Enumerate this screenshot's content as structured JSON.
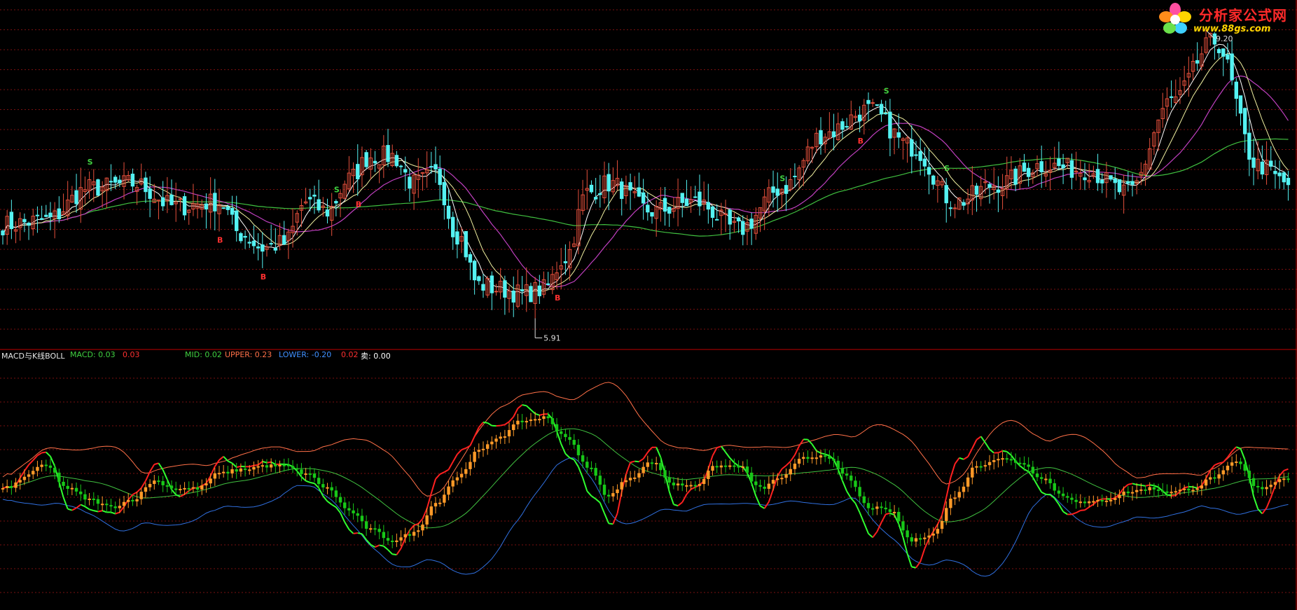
{
  "logo": {
    "name": "分析家公式网",
    "url": "www.88gs.com"
  },
  "colors": {
    "bg": "#000000",
    "grid": "#7a1010",
    "up": "#e5503c",
    "down": "#54f2f2",
    "ma_short": "#ffffff",
    "ma_mid": "#f0f0a0",
    "ma_long": "#c040c0",
    "ma_longest": "#40c040",
    "bar_up": "#ff9a28",
    "bar_down": "#18c818",
    "upper": "#ff7048",
    "mid": "#40c040",
    "lower": "#3070e0",
    "red_line": "#ff2020",
    "green_line": "#30ff30",
    "divider": "#c00000"
  },
  "price_panel": {
    "high_label": "9.20",
    "low_label": "5.91"
  },
  "indicator_legend": {
    "title": "MACD与K线BOLL",
    "macd_label": "MACD: 0.03",
    "macd_value2": "0.03",
    "mid_label": "MID: 0.02",
    "upper_label": "UPPER: 0.23",
    "lower_label": "LOWER: -0.20",
    "value4": "0.02",
    "sell_label": "卖: 0.00"
  },
  "chart_data": [
    {
      "type": "candlestick",
      "title": "",
      "series": [
        {
          "name": "",
          "anchors_x": [
            0,
            10,
            20,
            30,
            40,
            50,
            55,
            60,
            65,
            70,
            75,
            80,
            85,
            90,
            95,
            100,
            105,
            110,
            115,
            120,
            125,
            130,
            135,
            140,
            150,
            160,
            170,
            180,
            190,
            200,
            210,
            220,
            230,
            240,
            250,
            260,
            270,
            280,
            290,
            297
          ],
          "anchors_close": [
            6.95,
            7.0,
            7.35,
            7.4,
            7.15,
            7.2,
            6.85,
            6.7,
            6.75,
            7.2,
            7.1,
            7.45,
            7.7,
            7.7,
            7.4,
            7.5,
            6.85,
            6.3,
            6.25,
            6.2,
            6.25,
            6.6,
            7.3,
            7.4,
            7.1,
            7.2,
            6.9,
            7.35,
            7.95,
            8.2,
            7.8,
            7.2,
            7.4,
            7.6,
            7.55,
            7.3,
            8.3,
            8.95,
            7.6,
            7.4
          ]
        }
      ],
      "marker_labels": [
        "S",
        "B"
      ],
      "ylim": [
        5.6,
        9.4
      ],
      "grid": true
    },
    {
      "type": "bar",
      "title": "MACD与K线BOLL",
      "anchors_x": [
        0,
        10,
        15,
        20,
        25,
        30,
        35,
        40,
        45,
        50,
        55,
        60,
        65,
        70,
        75,
        80,
        85,
        90,
        95,
        100,
        105,
        110,
        115,
        120,
        125,
        130,
        135,
        140,
        145,
        150,
        155,
        160,
        165,
        170,
        175,
        180,
        185,
        190,
        195,
        200,
        205,
        210,
        215,
        220,
        225,
        230,
        235,
        240,
        245,
        250,
        255,
        260,
        265,
        270,
        275,
        280,
        285,
        290,
        297
      ],
      "anchors_value": [
        0.0,
        0.06,
        0.0,
        -0.03,
        -0.05,
        -0.03,
        0.02,
        0.0,
        0.0,
        0.04,
        0.05,
        0.06,
        0.06,
        0.04,
        0.0,
        -0.06,
        -0.11,
        -0.14,
        -0.12,
        -0.04,
        0.03,
        0.1,
        0.14,
        0.18,
        0.19,
        0.14,
        0.06,
        -0.02,
        0.03,
        0.07,
        0.01,
        0.01,
        0.06,
        0.06,
        0.0,
        0.03,
        0.08,
        0.09,
        0.03,
        -0.05,
        -0.06,
        -0.14,
        -0.12,
        -0.02,
        0.06,
        0.08,
        0.07,
        0.03,
        -0.02,
        -0.04,
        -0.03,
        -0.01,
        0.0,
        -0.01,
        0.0,
        0.03,
        0.07,
        0.0,
        0.03
      ],
      "ylim": [
        -0.32,
        0.34
      ],
      "grid": true
    }
  ]
}
